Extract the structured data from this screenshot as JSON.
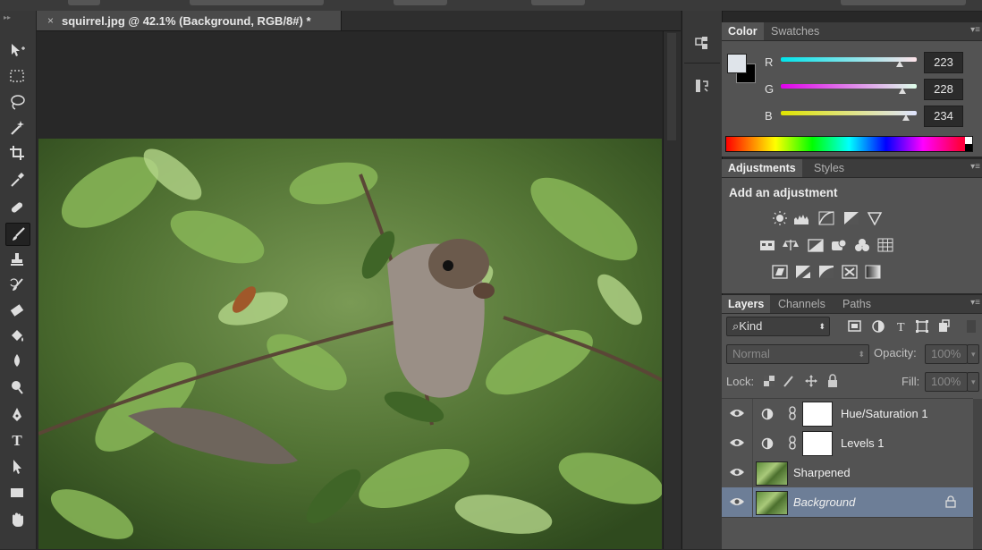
{
  "document": {
    "tab_title": "squirrel.jpg @ 42.1% (Background, RGB/8#) *",
    "close_glyph": "×"
  },
  "tools": [
    {
      "name": "move-tool-icon"
    },
    {
      "name": "marquee-tool-icon"
    },
    {
      "name": "lasso-tool-icon"
    },
    {
      "name": "magic-wand-tool-icon"
    },
    {
      "name": "crop-tool-icon"
    },
    {
      "name": "eyedropper-tool-icon"
    },
    {
      "name": "healing-brush-tool-icon"
    },
    {
      "name": "brush-tool-icon",
      "active": true
    },
    {
      "name": "clone-stamp-tool-icon"
    },
    {
      "name": "history-brush-tool-icon"
    },
    {
      "name": "eraser-tool-icon"
    },
    {
      "name": "paint-bucket-tool-icon"
    },
    {
      "name": "blur-tool-icon"
    },
    {
      "name": "dodge-tool-icon"
    },
    {
      "name": "pen-tool-icon"
    },
    {
      "name": "type-tool-icon",
      "glyph": "T"
    },
    {
      "name": "path-selection-tool-icon"
    },
    {
      "name": "rectangle-tool-icon"
    },
    {
      "name": "hand-tool-icon"
    }
  ],
  "color_panel": {
    "tabs": [
      "Color",
      "Swatches"
    ],
    "foreground": "#dfe4ea",
    "background": "#000000",
    "channels": [
      {
        "label": "R",
        "value": "223",
        "gradient": [
          "#00e4ea",
          "#ffe4ea"
        ],
        "fraction": 0.875
      },
      {
        "label": "G",
        "value": "228",
        "gradient": [
          "#df00ea",
          "#dfffea"
        ],
        "fraction": 0.894
      },
      {
        "label": "B",
        "value": "234",
        "gradient": [
          "#dfe400",
          "#dfe4ff"
        ],
        "fraction": 0.918
      }
    ]
  },
  "adjustments_panel": {
    "tabs": [
      "Adjustments",
      "Styles"
    ],
    "heading": "Add an adjustment",
    "icons": [
      [
        "brightness-contrast-icon",
        "levels-icon",
        "curves-icon",
        "exposure-icon",
        "vibrance-icon"
      ],
      [
        "hue-saturation-icon",
        "color-balance-icon",
        "black-white-icon",
        "photo-filter-icon",
        "channel-mixer-icon",
        "color-lookup-icon"
      ],
      [
        "invert-icon",
        "posterize-icon",
        "threshold-icon",
        "selective-color-icon",
        "gradient-map-icon"
      ]
    ]
  },
  "layers_panel": {
    "tabs": [
      "Layers",
      "Channels",
      "Paths"
    ],
    "filter_kind": "Kind",
    "blend_mode": "Normal",
    "opacity_label": "Opacity:",
    "opacity_value": "100%",
    "lock_label": "Lock:",
    "fill_label": "Fill:",
    "fill_value": "100%",
    "layers": [
      {
        "name": "Hue/Saturation 1",
        "type": "adjustment",
        "selected": false
      },
      {
        "name": "Levels 1",
        "type": "adjustment",
        "selected": false
      },
      {
        "name": "Sharpened",
        "type": "pixel",
        "selected": false
      },
      {
        "name": "Background",
        "type": "background",
        "selected": true,
        "locked": true
      }
    ]
  }
}
